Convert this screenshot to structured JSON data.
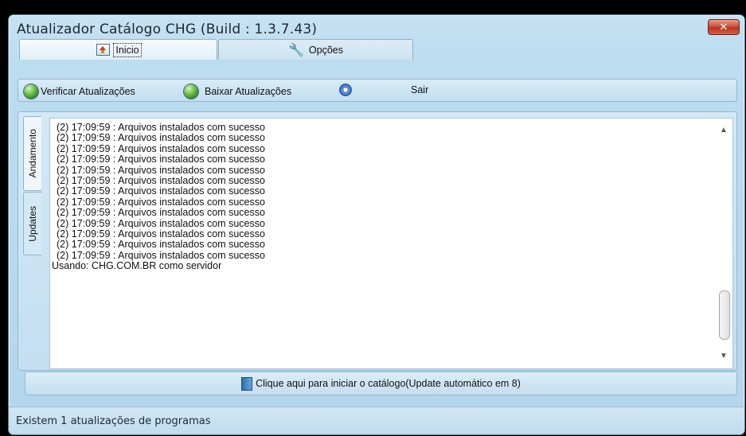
{
  "window": {
    "title": "Atualizador Catálogo CHG  (Build : 1.3.7.43)",
    "close_symbol": "✕"
  },
  "tabs": [
    {
      "label": "Inicio",
      "icon": "home-icon",
      "active": true
    },
    {
      "label": "Opções",
      "icon": "wrench-icon",
      "active": false
    }
  ],
  "toolbar": {
    "check_updates_label": "Verificar Atualizações",
    "download_updates_label": "Baixar Atualizações",
    "exit_label": "Sair"
  },
  "side_tabs": [
    {
      "label": "Andamento",
      "active": true
    },
    {
      "label": "Updates",
      "active": false
    }
  ],
  "log": {
    "lines": [
      "(2) 17:09:59 : Arquivos instalados com sucesso",
      "(2) 17:09:59 : Arquivos instalados com sucesso",
      "(2) 17:09:59 : Arquivos instalados com sucesso",
      "(2) 17:09:59 : Arquivos instalados com sucesso",
      "(2) 17:09:59 : Arquivos instalados com sucesso",
      "(2) 17:09:59 : Arquivos instalados com sucesso",
      "(2) 17:09:59 : Arquivos instalados com sucesso",
      "(2) 17:09:59 : Arquivos instalados com sucesso",
      "(2) 17:09:59 : Arquivos instalados com sucesso",
      "(2) 17:09:59 : Arquivos instalados com sucesso",
      "(2) 17:09:59 : Arquivos instalados com sucesso",
      "(2) 17:09:59 : Arquivos instalados com sucesso",
      "(2) 17:09:59 : Arquivos instalados com sucesso"
    ],
    "server_line": "Usando: CHG.COM.BR como servidor"
  },
  "launch": {
    "label": "Clique aqui para iniciar o catálogo(Update automático em 8)"
  },
  "status": {
    "text": "Existem 1 atualizações de programas"
  },
  "colors": {
    "window_bg": "#bcdcef",
    "close_button": "#cd4a36",
    "log_bg": "#ffffff"
  }
}
